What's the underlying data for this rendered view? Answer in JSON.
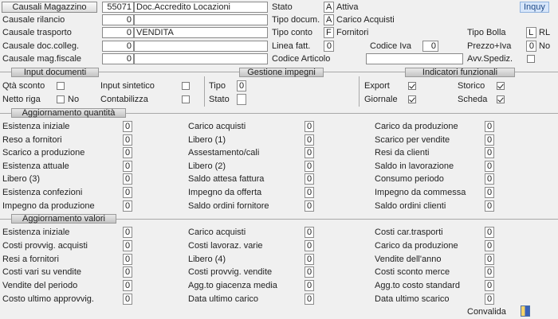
{
  "header": {
    "title_button": "Causali Magazzino",
    "code": "55071",
    "description": "Doc.Accredito Locazioni",
    "mode_badge": "Inquy"
  },
  "fields": {
    "causale_rilancio": {
      "label": "Causale rilancio",
      "value": "0",
      "desc": ""
    },
    "causale_trasporto": {
      "label": "Causale trasporto",
      "value": "0",
      "desc": "VENDITA"
    },
    "causale_doc_colleg": {
      "label": "Causale doc.colleg.",
      "value": "0",
      "desc": ""
    },
    "causale_mag_fiscale": {
      "label": "Causale mag.fiscale",
      "value": "0",
      "desc": ""
    },
    "stato": {
      "label": "Stato",
      "code": "A",
      "desc": "Attiva"
    },
    "tipo_docum": {
      "label": "Tipo docum.",
      "code": "A",
      "desc": "Carico Acquisti"
    },
    "tipo_conto": {
      "label": "Tipo conto",
      "code": "F",
      "desc": "Fornitori"
    },
    "linea_fatt": {
      "label": "Linea fatt.",
      "value": "0"
    },
    "codice_iva": {
      "label": "Codice Iva",
      "value": "0"
    },
    "codice_articolo": {
      "label": "Codice Articolo",
      "value": ""
    },
    "tipo_bolla": {
      "label": "Tipo Bolla",
      "code": "L",
      "desc": "RL"
    },
    "prezzo_iva": {
      "label": "Prezzo+Iva",
      "code": "0",
      "desc": "No"
    },
    "avv_spediz": {
      "label": "Avv.Spediz."
    }
  },
  "sections": {
    "input_documenti": "Input documenti",
    "gestione_impegni": "Gestione impegni",
    "indicatori_funzionali": "Indicatori funzionali",
    "aggiornamento_quantita": "Aggiornamento quantità",
    "aggiornamento_valori": "Aggiornamento valori"
  },
  "input_documenti": {
    "qta_sconto": "Qtà sconto",
    "netto_riga": "Netto riga",
    "netto_riga_value": "No",
    "input_sintetico": "Input sintetico",
    "contabilizza": "Contabilizza"
  },
  "gestione_impegni": {
    "tipo": "Tipo",
    "tipo_value": "0",
    "stato": "Stato",
    "stato_value": ""
  },
  "indicatori": {
    "export": "Export",
    "giornale": "Giornale",
    "storico": "Storico",
    "scheda": "Scheda"
  },
  "qty": {
    "col1": [
      {
        "label": "Esistenza iniziale",
        "value": "0"
      },
      {
        "label": "Reso    a fornitori",
        "value": "0"
      },
      {
        "label": "Scarico a produzione",
        "value": "0"
      },
      {
        "label": "Esistenza attuale",
        "value": "0"
      },
      {
        "label": "Libero (3)",
        "value": "0"
      },
      {
        "label": "Esistenza confezioni",
        "value": "0"
      },
      {
        "label": "Impegno da produzione",
        "value": "0"
      }
    ],
    "col2": [
      {
        "label": "Carico acquisti",
        "value": "0"
      },
      {
        "label": "Libero (1)",
        "value": "0"
      },
      {
        "label": "Assestamento/cali",
        "value": "0"
      },
      {
        "label": "Libero (2)",
        "value": "0"
      },
      {
        "label": "Saldo attesa fattura",
        "value": "0"
      },
      {
        "label": "Impegno da offerta",
        "value": "0"
      },
      {
        "label": "Saldo ordini fornitore",
        "value": "0"
      }
    ],
    "col3": [
      {
        "label": "Carico da produzione",
        "value": "0"
      },
      {
        "label": "Scarico per vendite",
        "value": "0"
      },
      {
        "label": "Resi  da clienti",
        "value": "0"
      },
      {
        "label": "Saldo in lavorazione",
        "value": "0"
      },
      {
        "label": "Consumo periodo",
        "value": "0"
      },
      {
        "label": "Impegno da commessa",
        "value": "0"
      },
      {
        "label": "Saldo ordini clienti",
        "value": "0"
      }
    ]
  },
  "val": {
    "col1": [
      {
        "label": "Esistenza iniziale",
        "value": "0"
      },
      {
        "label": "Costi provvig. acquisti",
        "value": "0"
      },
      {
        "label": "Resi a fornitori",
        "value": "0"
      },
      {
        "label": "Costi vari su vendite",
        "value": "0"
      },
      {
        "label": "Vendite del periodo",
        "value": "0"
      },
      {
        "label": "Costo ultimo approvvig.",
        "value": "0"
      }
    ],
    "col2": [
      {
        "label": "Carico acquisti",
        "value": "0"
      },
      {
        "label": "Costi lavoraz. varie",
        "value": "0"
      },
      {
        "label": "Libero (4)",
        "value": "0"
      },
      {
        "label": "Costi provvig. vendite",
        "value": "0"
      },
      {
        "label": "Agg.to giacenza media",
        "value": "0"
      },
      {
        "label": "Data ultimo carico",
        "value": "0"
      }
    ],
    "col3": [
      {
        "label": "Costi  car.trasporti",
        "value": "0"
      },
      {
        "label": "Carico da produzione",
        "value": "0"
      },
      {
        "label": "Vendite dell'anno",
        "value": "0"
      },
      {
        "label": "Costi sconto merce",
        "value": "0"
      },
      {
        "label": "Agg.to costo standard",
        "value": "0"
      },
      {
        "label": "Data ultimo scarico",
        "value": "0"
      }
    ]
  },
  "footer": {
    "convalida": "Convalida"
  }
}
